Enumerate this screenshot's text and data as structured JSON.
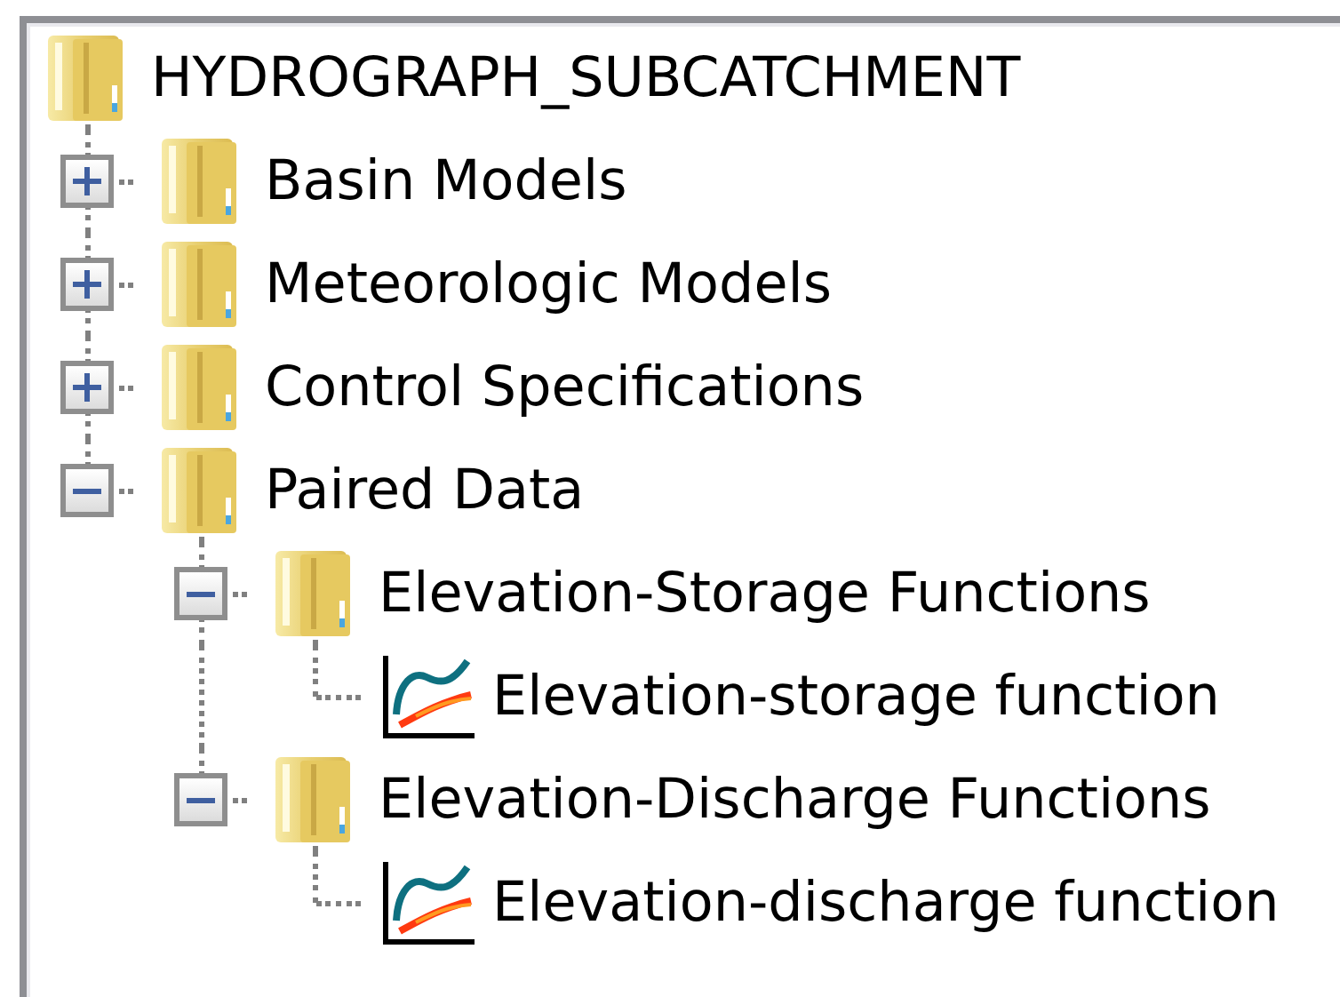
{
  "tree": {
    "label": "HYDROGRAPH_SUBCATCHMENT",
    "kind": "folder",
    "children": [
      {
        "label": "Basin Models",
        "kind": "folder",
        "expanded": false
      },
      {
        "label": "Meteorologic Models",
        "kind": "folder",
        "expanded": false
      },
      {
        "label": "Control Specifications",
        "kind": "folder",
        "expanded": false
      },
      {
        "label": "Paired Data",
        "kind": "folder",
        "expanded": true,
        "children": [
          {
            "label": "Elevation-Storage Functions",
            "kind": "folder",
            "expanded": true,
            "children": [
              {
                "label": "Elevation-storage function",
                "kind": "function"
              }
            ]
          },
          {
            "label": "Elevation-Discharge Functions",
            "kind": "folder",
            "expanded": true,
            "children": [
              {
                "label": "Elevation-discharge function",
                "kind": "function"
              }
            ]
          }
        ]
      }
    ]
  }
}
